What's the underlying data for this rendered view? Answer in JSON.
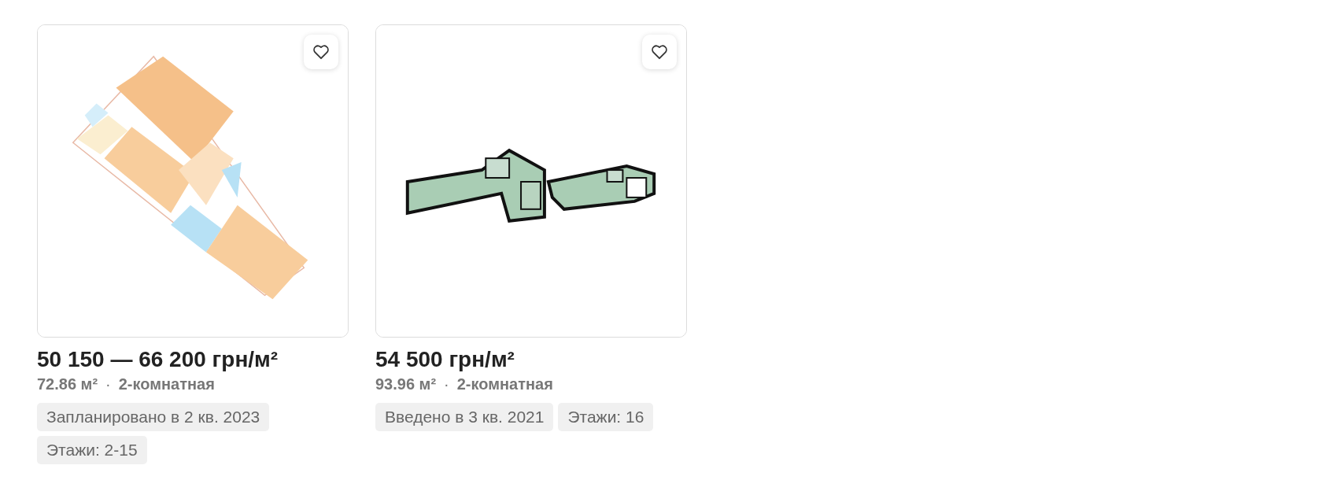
{
  "listings": [
    {
      "price": "50 150 — 66 200 грн/м²",
      "area": "72.86 м²",
      "separator": "·",
      "rooms": "2-комнатная",
      "tags": [
        "Запланировано в 2 кв. 2023",
        "Этажи: 2-15"
      ]
    },
    {
      "price": "54 500 грн/м²",
      "area": "93.96 м²",
      "separator": "·",
      "rooms": "2-комнатная",
      "tags": [
        "Введено в 3 кв. 2021",
        "Этажи: 16"
      ]
    }
  ]
}
